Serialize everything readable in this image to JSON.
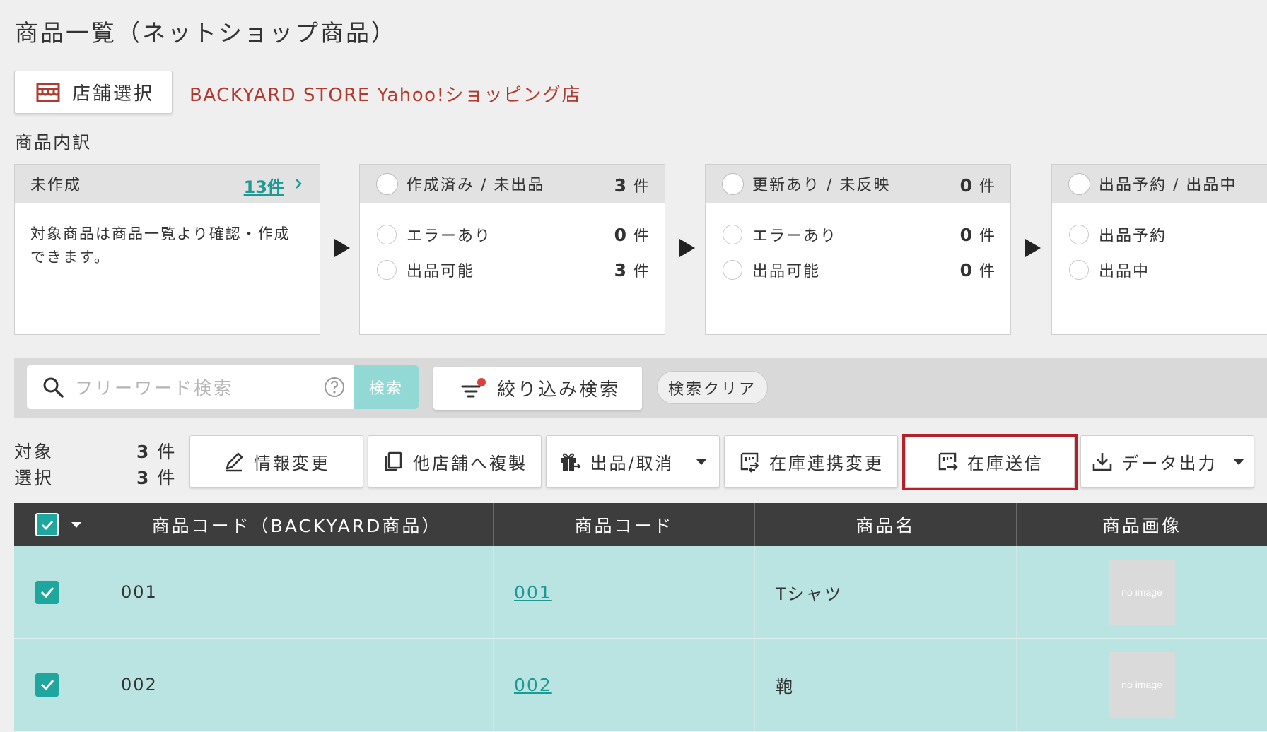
{
  "page": {
    "title": "商品一覧（ネットショップ商品）"
  },
  "store": {
    "button_label": "店舗選択",
    "name": "BACKYARD STORE Yahoo!ショッピング店"
  },
  "breakdown": {
    "label": "商品内訳",
    "cards": [
      {
        "title": "未作成",
        "count_link": "13件",
        "description": "対象商品は商品一覧より確認・作成できます。"
      },
      {
        "title": "作成済み / 未出品",
        "count": "3",
        "unit": "件",
        "rows": [
          {
            "label": "エラーあり",
            "count": "0",
            "unit": "件"
          },
          {
            "label": "出品可能",
            "count": "3",
            "unit": "件"
          }
        ]
      },
      {
        "title": "更新あり / 未反映",
        "count": "0",
        "unit": "件",
        "rows": [
          {
            "label": "エラーあり",
            "count": "0",
            "unit": "件"
          },
          {
            "label": "出品可能",
            "count": "0",
            "unit": "件"
          }
        ]
      },
      {
        "title": "出品予約 / 出品中",
        "rows": [
          {
            "label": "出品予約"
          },
          {
            "label": "出品中"
          }
        ]
      }
    ]
  },
  "search": {
    "placeholder": "フリーワード検索",
    "search_button": "検索",
    "filter_button": "絞り込み検索",
    "clear_button": "検索クリア"
  },
  "counts": {
    "target_label": "対象",
    "target_count": "3",
    "selected_label": "選択",
    "selected_count": "3",
    "unit": "件"
  },
  "actions": {
    "edit_info": "情報変更",
    "copy_to_store": "他店舗へ複製",
    "list_cancel": "出品/取消",
    "inventory_link_change": "在庫連携変更",
    "send_inventory": "在庫送信",
    "data_export": "データ出力"
  },
  "table": {
    "columns": [
      "商品コード（BACKYARD商品）",
      "商品コード",
      "商品名",
      "商品画像"
    ],
    "rows": [
      {
        "backyard_code": "001",
        "product_code": "001",
        "name": "Tシャツ",
        "image": "no image",
        "checked": true
      },
      {
        "backyard_code": "002",
        "product_code": "002",
        "name": "鞄",
        "image": "no image",
        "checked": true
      }
    ]
  },
  "colors": {
    "accent_teal": "#1fa69e",
    "row_selected_bg": "#b9e4e1",
    "store_name_red": "#b03a2e",
    "highlight_red": "#b3202a",
    "table_header_bg": "#3d3d3d"
  },
  "icons": {
    "store_button": "store-icon",
    "search": "search-icon",
    "help": "help-icon",
    "filter": "filter-icon",
    "edit": "pencil-icon",
    "copy": "copy-icon",
    "list_cancel": "gift-icon",
    "inventory_link": "inventory-link-icon",
    "send_inventory": "send-inventory-icon",
    "export": "download-icon"
  }
}
